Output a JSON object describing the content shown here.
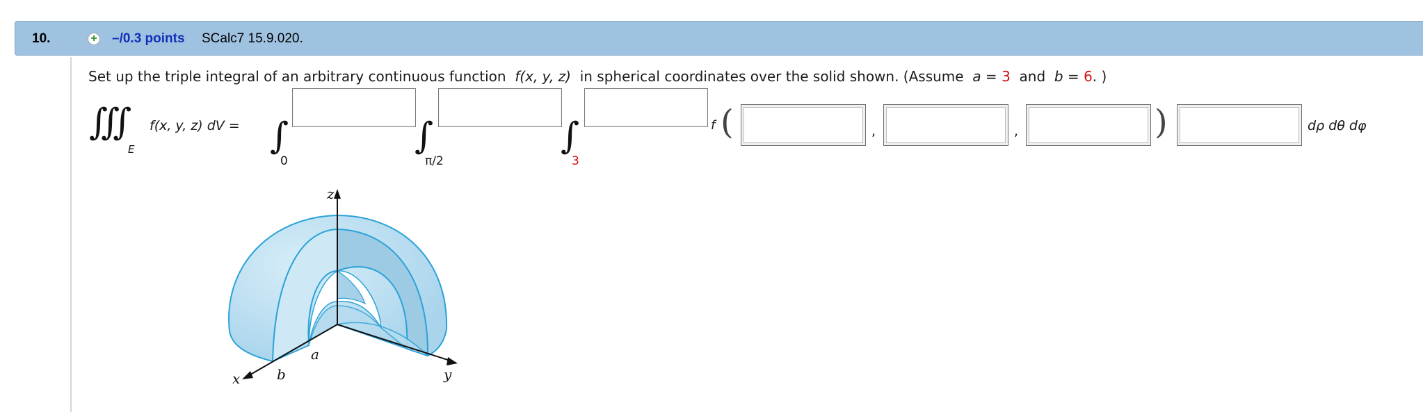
{
  "question": {
    "number": "10.",
    "add_icon": "plus-circle-icon",
    "points": "–/0.3 points",
    "id": "SCalc7 15.9.020."
  },
  "prompt": {
    "text_before": "Set up the triple integral of an arbitrary continuous function",
    "function": "f(x, y, z)",
    "text_after": "in spherical coordinates over the solid shown. (Assume",
    "a_var": "a",
    "a_eq": " = ",
    "a_value": "3",
    "and": "and",
    "b_var": "b",
    "b_eq": " = ",
    "b_value": "6",
    "end": ". )"
  },
  "integral": {
    "lhs_symbol": "∭",
    "lhs_region": "E",
    "lhs_expr": "f(x, y, z) dV =",
    "lower_limits": [
      "0",
      "π/2",
      "3"
    ],
    "upper_limits": [
      "",
      "",
      ""
    ],
    "f_label": "f",
    "args": [
      "",
      "",
      ""
    ],
    "comma": ",",
    "jacobian": "",
    "differentials": "dρ dθ dφ"
  },
  "figure": {
    "z_label": "z",
    "x_label": "x",
    "y_label": "y",
    "a_label": "a",
    "b_label": "b"
  },
  "colors": {
    "header_bg": "#9ec2e0",
    "points_text": "#1230b8",
    "given_value": "#d01010",
    "solid_fill": "#b8dcef",
    "solid_edge": "#2aa2d8"
  }
}
